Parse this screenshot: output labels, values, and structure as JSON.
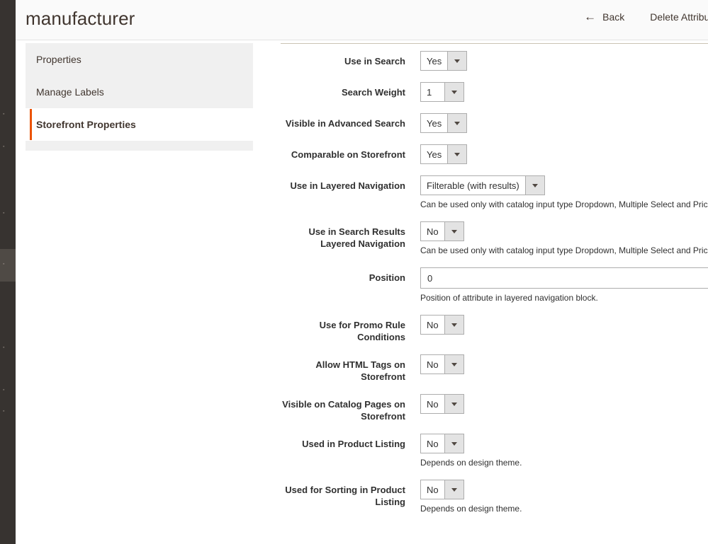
{
  "header": {
    "title": "manufacturer",
    "back_label": "Back",
    "back_icon": "arrow-left-icon",
    "delete_label": "Delete Attribute"
  },
  "tabs": [
    {
      "label": "Properties",
      "active": false
    },
    {
      "label": "Manage Labels",
      "active": false
    },
    {
      "label": "Storefront Properties",
      "active": true
    }
  ],
  "theme": {
    "accent": "#eb5202",
    "admin_nav_bg": "#373330",
    "header_bg": "#fafafa",
    "tab_inactive_bg": "#f0f0f0",
    "divider": "#cac3b4"
  },
  "form": {
    "fields": [
      {
        "label": "Use in Search",
        "control": "select",
        "value": "Yes",
        "size": "sm",
        "note": ""
      },
      {
        "label": "Search Weight",
        "control": "select",
        "value": "1",
        "size": "sm",
        "note": ""
      },
      {
        "label": "Visible in Advanced Search",
        "control": "select",
        "value": "Yes",
        "size": "sm",
        "note": ""
      },
      {
        "label": "Comparable on Storefront",
        "control": "select",
        "value": "Yes",
        "size": "sm",
        "note": ""
      },
      {
        "label": "Use in Layered Navigation",
        "control": "select",
        "value": "Filterable (with results)",
        "size": "lg",
        "note": "Can be used only with catalog input type Dropdown, Multiple Select and Price."
      },
      {
        "label": "Use in Search Results Layered Navigation",
        "control": "select",
        "value": "No",
        "size": "sm",
        "note": "Can be used only with catalog input type Dropdown, Multiple Select and Price."
      },
      {
        "label": "Position",
        "control": "text",
        "value": "0",
        "size": "",
        "note": "Position of attribute in layered navigation block."
      },
      {
        "label": "Use for Promo Rule Conditions",
        "control": "select",
        "value": "No",
        "size": "sm",
        "note": ""
      },
      {
        "label": "Allow HTML Tags on Storefront",
        "control": "select",
        "value": "No",
        "size": "sm",
        "note": ""
      },
      {
        "label": "Visible on Catalog Pages on Storefront",
        "control": "select",
        "value": "No",
        "size": "sm",
        "note": ""
      },
      {
        "label": "Used in Product Listing",
        "control": "select",
        "value": "No",
        "size": "sm",
        "note": "Depends on design theme."
      },
      {
        "label": "Used for Sorting in Product Listing",
        "control": "select",
        "value": "No",
        "size": "sm",
        "note": "Depends on design theme."
      }
    ]
  }
}
